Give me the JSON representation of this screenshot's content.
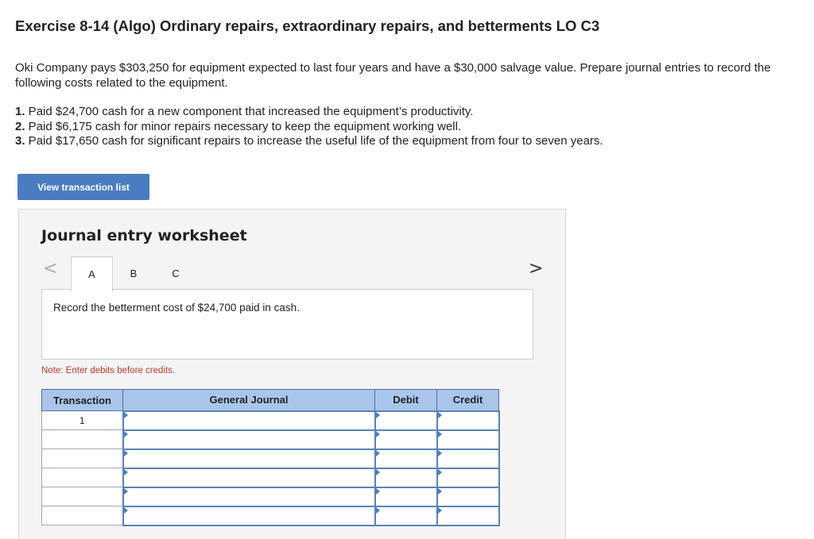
{
  "header": {
    "title": "Exercise 8-14 (Algo) Ordinary repairs, extraordinary repairs, and betterments LO C3"
  },
  "problem": {
    "intro": "Oki Company pays $303,250 for equipment expected to last four years and have a $30,000 salvage value. Prepare journal entries to record the following costs related to the equipment.",
    "items": [
      {
        "num": "1.",
        "text": " Paid $24,700 cash for a new component that increased the equipment’s productivity."
      },
      {
        "num": "2.",
        "text": " Paid $6,175 cash for minor repairs necessary to keep the equipment working well."
      },
      {
        "num": "3.",
        "text": " Paid $17,650 cash for significant repairs to increase the useful life of the equipment from four to seven years."
      }
    ]
  },
  "buttons": {
    "view_transaction_list": "View transaction list"
  },
  "worksheet": {
    "title": "Journal entry worksheet",
    "nav_prev": "<",
    "nav_next": ">",
    "tabs": [
      "A",
      "B",
      "C"
    ],
    "active_tab": "A",
    "instruction": "Record the betterment cost of $24,700 paid in cash.",
    "note": "Note: Enter debits before credits.",
    "table": {
      "headers": [
        "Transaction",
        "General Journal",
        "Debit",
        "Credit"
      ],
      "rows": [
        {
          "transaction": "1",
          "general_journal": "",
          "debit": "",
          "credit": ""
        },
        {
          "transaction": "",
          "general_journal": "",
          "debit": "",
          "credit": ""
        },
        {
          "transaction": "",
          "general_journal": "",
          "debit": "",
          "credit": ""
        },
        {
          "transaction": "",
          "general_journal": "",
          "debit": "",
          "credit": ""
        },
        {
          "transaction": "",
          "general_journal": "",
          "debit": "",
          "credit": ""
        },
        {
          "transaction": "",
          "general_journal": "",
          "debit": "",
          "credit": ""
        }
      ]
    }
  },
  "colors": {
    "accent": "#4a7cc1",
    "table_header": "#a9c6ea",
    "note": "#c0392b"
  }
}
